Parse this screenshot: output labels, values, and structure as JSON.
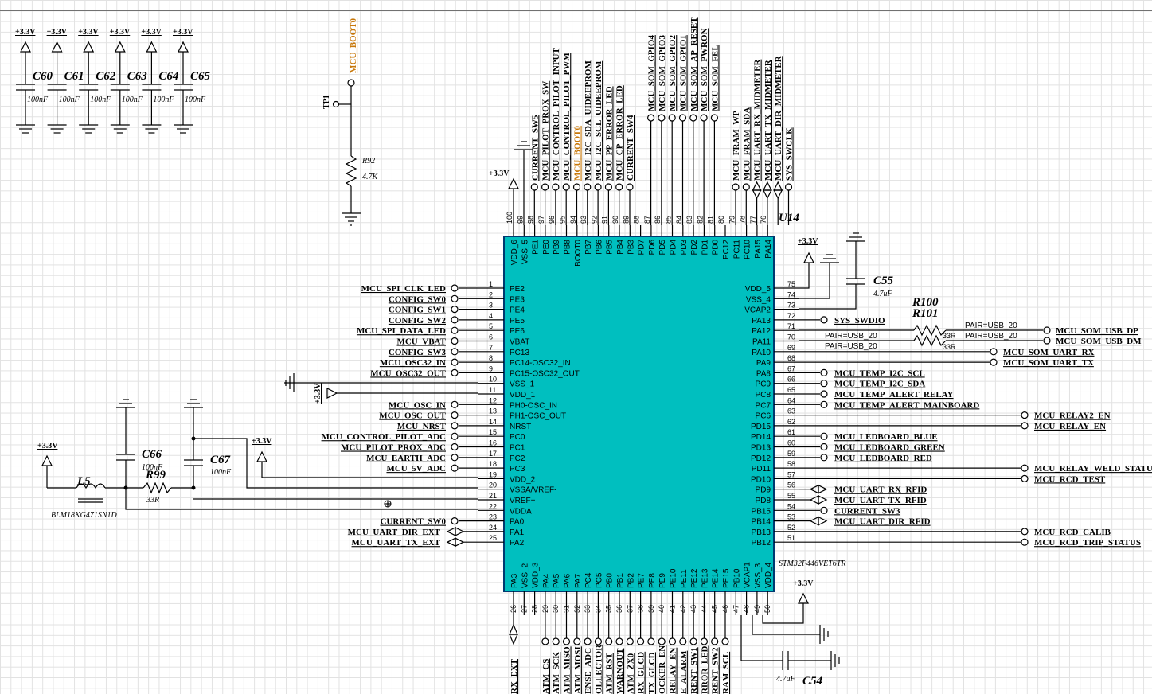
{
  "power": {
    "label": "+3.3V"
  },
  "decoupling": {
    "caps": [
      {
        "ref": "C60",
        "value": "100nF"
      },
      {
        "ref": "C61",
        "value": "100nF"
      },
      {
        "ref": "C62",
        "value": "100nF"
      },
      {
        "ref": "C63",
        "value": "100nF"
      },
      {
        "ref": "C64",
        "value": "100nF"
      },
      {
        "ref": "C65",
        "value": "100nF"
      }
    ]
  },
  "boot": {
    "net": "MCU_BOOT0",
    "tp": "TP1",
    "resistor_ref": "R92",
    "resistor_value": "4.7K"
  },
  "ic": {
    "ref": "U14",
    "part": "STM32F446VET6TR",
    "color": "#00bfbf",
    "left_pins": [
      {
        "num": "1",
        "name": "PE2",
        "net": "MCU_SPI_CLK_LED",
        "end": "circle"
      },
      {
        "num": "2",
        "name": "PE3",
        "net": "CONFIG_SW0",
        "end": "circle"
      },
      {
        "num": "3",
        "name": "PE4",
        "net": "CONFIG_SW1",
        "end": "circle"
      },
      {
        "num": "4",
        "name": "PE5",
        "net": "CONFIG_SW2",
        "end": "circle"
      },
      {
        "num": "5",
        "name": "PE6",
        "net": "MCU_SPI_DATA_LED",
        "end": "circle"
      },
      {
        "num": "6",
        "name": "VBAT",
        "net": "MCU_VBAT",
        "end": "circle"
      },
      {
        "num": "7",
        "name": "PC13",
        "net": "CONFIG_SW3",
        "end": "circle"
      },
      {
        "num": "8",
        "name": "PC14-OSC32_IN",
        "net": "MCU_OSC32_IN",
        "end": "circle"
      },
      {
        "num": "9",
        "name": "PC15-OSC32_OUT",
        "net": "MCU_OSC32_OUT",
        "end": "circle"
      },
      {
        "num": "10",
        "name": "VSS_1",
        "net": "",
        "end": "gnd"
      },
      {
        "num": "11",
        "name": "VDD_1",
        "net": "",
        "end": "pwr"
      },
      {
        "num": "12",
        "name": "PH0-OSC_IN",
        "net": "MCU_OSC_IN",
        "end": "circle"
      },
      {
        "num": "13",
        "name": "PH1-OSC_OUT",
        "net": "MCU_OSC_OUT",
        "end": "circle"
      },
      {
        "num": "14",
        "name": "NRST",
        "net": "MCU_NRST",
        "end": "circle"
      },
      {
        "num": "15",
        "name": "PC0",
        "net": "MCU_CONTROL_PILOT_ADC",
        "end": "circle"
      },
      {
        "num": "16",
        "name": "PC1",
        "net": "MCU_PILOT_PROX_ADC",
        "end": "circle"
      },
      {
        "num": "17",
        "name": "PC2",
        "net": "MCU_EARTH_ADC",
        "end": "circle"
      },
      {
        "num": "18",
        "name": "PC3",
        "net": "MCU_5V_ADC",
        "end": "circle"
      },
      {
        "num": "19",
        "name": "VDD_2",
        "net": "",
        "end": "none"
      },
      {
        "num": "20",
        "name": "VSSA/VREF-",
        "net": "",
        "end": "none"
      },
      {
        "num": "21",
        "name": "VREF+",
        "net": "",
        "end": "none"
      },
      {
        "num": "22",
        "name": "VDDA",
        "net": "",
        "end": "none"
      },
      {
        "num": "23",
        "name": "PA0",
        "net": "CURRENT_SW0",
        "end": "circle"
      },
      {
        "num": "24",
        "name": "PA1",
        "net": "MCU_UART_DIR_EXT",
        "end": "bidir"
      },
      {
        "num": "25",
        "name": "PA2",
        "net": "MCU_UART_TX_EXT",
        "end": "bidir"
      }
    ],
    "right_pins": [
      {
        "num": "75",
        "name": "VDD_5",
        "net": "",
        "end": "none"
      },
      {
        "num": "74",
        "name": "VSS_4",
        "net": "",
        "end": "none"
      },
      {
        "num": "73",
        "name": "VCAP2",
        "net": "",
        "end": "none"
      },
      {
        "num": "72",
        "name": "PA13",
        "net": "SYS_SWDIO",
        "end": "circle"
      },
      {
        "num": "71",
        "name": "PA12",
        "net": "",
        "end": "none"
      },
      {
        "num": "70",
        "name": "PA11",
        "net": "",
        "end": "none"
      },
      {
        "num": "69",
        "name": "PA10",
        "net": "MCU_SOM_UART_RX",
        "end": "far"
      },
      {
        "num": "68",
        "name": "PA9",
        "net": "MCU_SOM_UART_TX",
        "end": "far"
      },
      {
        "num": "67",
        "name": "PA8",
        "net": "MCU_TEMP_I2C_SCL",
        "end": "circle"
      },
      {
        "num": "66",
        "name": "PC9",
        "net": "MCU_TEMP_I2C_SDA",
        "end": "circle"
      },
      {
        "num": "65",
        "name": "PC8",
        "net": "MCU_TEMP_ALERT_RELAY",
        "end": "circle"
      },
      {
        "num": "64",
        "name": "PC7",
        "net": "MCU_TEMP_ALERT_MAINBOARD",
        "end": "circle"
      },
      {
        "num": "63",
        "name": "PC6",
        "net": "MCU_RELAY2_EN",
        "end": "far2"
      },
      {
        "num": "62",
        "name": "PD15",
        "net": "MCU_RELAY_EN",
        "end": "far2"
      },
      {
        "num": "61",
        "name": "PD14",
        "net": "MCU_LEDBOARD_BLUE",
        "end": "circle"
      },
      {
        "num": "60",
        "name": "PD13",
        "net": "MCU_LEDBOARD_GREEN",
        "end": "circle"
      },
      {
        "num": "59",
        "name": "PD12",
        "net": "MCU_LEDBOARD_RED",
        "end": "circle"
      },
      {
        "num": "58",
        "name": "PD11",
        "net": "MCU_RELAY_WELD_STATUS",
        "end": "far2"
      },
      {
        "num": "57",
        "name": "PD10",
        "net": "MCU_RCD_TEST",
        "end": "far2"
      },
      {
        "num": "56",
        "name": "PD9",
        "net": "MCU_UART_RX_RFID",
        "end": "bidir"
      },
      {
        "num": "55",
        "name": "PD8",
        "net": "MCU_UART_TX_RFID",
        "end": "bidir"
      },
      {
        "num": "54",
        "name": "PB15",
        "net": "CURRENT_SW3",
        "end": "circle"
      },
      {
        "num": "53",
        "name": "PB14",
        "net": "MCU_UART_DIR_RFID",
        "end": "bidir"
      },
      {
        "num": "52",
        "name": "PB13",
        "net": "MCU_RCD_CALIB",
        "end": "far2"
      },
      {
        "num": "51",
        "name": "PB12",
        "net": "MCU_RCD_TRIP_STATUS",
        "end": "far2"
      }
    ],
    "top_pins": [
      {
        "num": "100",
        "name": "VDD_6",
        "net": ""
      },
      {
        "num": "99",
        "name": "VSS_5",
        "net": "CURRENT_SW5"
      },
      {
        "num": "98",
        "name": "PE1",
        "net": "MCU_PILOT_PROX_SW"
      },
      {
        "num": "97",
        "name": "PE0",
        "net": "MCU_CONTROL_PILOT_INPUT"
      },
      {
        "num": "96",
        "name": "PB9",
        "net": "MCU_CONTROL_PILOT_PWM"
      },
      {
        "num": "95",
        "name": "PB8",
        "net": "MCU_BOOT0"
      },
      {
        "num": "94",
        "name": "BOOT0",
        "net": "MCU_I2C_SDA_UIDEEPROM"
      },
      {
        "num": "93",
        "name": "PB7",
        "net": "MCU_I2C_SCL_UIDEEPROM"
      },
      {
        "num": "92",
        "name": "PB6",
        "net": "MCU_PP_ERROR_LED"
      },
      {
        "num": "91",
        "name": "PB5",
        "net": "MCU_CP_ERROR_LED"
      },
      {
        "num": "90",
        "name": "PB4",
        "net": "CURRENT_SW4"
      },
      {
        "num": "89",
        "name": "PB3",
        "net": ""
      },
      {
        "num": "88",
        "name": "PD7",
        "net": "MCU_SOM_GPIO4"
      },
      {
        "num": "87",
        "name": "PD6",
        "net": "MCU_SOM_GPIO3"
      },
      {
        "num": "86",
        "name": "PD5",
        "net": "MCU_SOM_GPIO2"
      },
      {
        "num": "85",
        "name": "PD4",
        "net": "MCU_SOM_GPIO1"
      },
      {
        "num": "84",
        "name": "PD3",
        "net": "MCU_SOM_AP_RESET"
      },
      {
        "num": "83",
        "name": "PD2",
        "net": "MCU_SOM_PWRON"
      },
      {
        "num": "82",
        "name": "PD1",
        "net": "MCU_SOM_FEL"
      },
      {
        "num": "81",
        "name": "PD0",
        "net": ""
      },
      {
        "num": "80",
        "name": "PC12",
        "net": "MCU_FRAM_WP"
      },
      {
        "num": "79",
        "name": "PC11",
        "net": "MCU_FRAM_SDA"
      },
      {
        "num": "78",
        "name": "PC10",
        "net": "MCU_UART_RX_MIDMETER"
      },
      {
        "num": "77",
        "name": "PA15",
        "net": "MCU_UART_TX_MIDMETER"
      },
      {
        "num": "76",
        "name": "PA14",
        "net": "MCU_UART_DIR_MIDMETER"
      },
      {
        "num": "",
        "name": "",
        "net": "SYS_SWCLK"
      }
    ],
    "bottom_pins": [
      {
        "num": "26",
        "name": "PA3",
        "net": "RX_EXT"
      },
      {
        "num": "27",
        "name": "VSS_2",
        "net": ""
      },
      {
        "num": "28",
        "name": "VDD_3",
        "net": ""
      },
      {
        "num": "29",
        "name": "PA4",
        "net": "ATM_CS"
      },
      {
        "num": "30",
        "name": "PA5",
        "net": "ATM_SCK"
      },
      {
        "num": "31",
        "name": "PA6",
        "net": "ATM_MISO"
      },
      {
        "num": "32",
        "name": "PA7",
        "net": "ATM_MOSI"
      },
      {
        "num": "33",
        "name": "PC4",
        "net": "ENSE_ADC"
      },
      {
        "num": "34",
        "name": "PC5",
        "net": "OLLECTOR"
      },
      {
        "num": "35",
        "name": "PB0",
        "net": "ATM_RST"
      },
      {
        "num": "36",
        "name": "PB1",
        "net": "WARNOUT"
      },
      {
        "num": "37",
        "name": "PB2",
        "net": "ATM_ZX0"
      },
      {
        "num": "38",
        "name": "PE7",
        "net": "RX_GLCD"
      },
      {
        "num": "39",
        "name": "PE8",
        "net": "TX_GLCD"
      },
      {
        "num": "40",
        "name": "PE9",
        "net": "OCKER_EN"
      },
      {
        "num": "41",
        "name": "PE10",
        "net": "RELAY_EN"
      },
      {
        "num": "42",
        "name": "PE11",
        "net": "E_ALARM"
      },
      {
        "num": "43",
        "name": "PE12",
        "net": "RENT_SW1"
      },
      {
        "num": "44",
        "name": "PE13",
        "net": "RROR_LED"
      },
      {
        "num": "45",
        "name": "PE14",
        "net": "RENT_SW2"
      },
      {
        "num": "46",
        "name": "PE15",
        "net": "RAM_SCL"
      },
      {
        "num": "47",
        "name": "PB10",
        "net": ""
      },
      {
        "num": "48",
        "name": "VCAP1",
        "net": ""
      },
      {
        "num": "49",
        "name": "VSS_3",
        "net": ""
      },
      {
        "num": "50",
        "name": "VDD_4",
        "net": ""
      }
    ]
  },
  "analog": {
    "ferrite": "L5",
    "ferrite_part": "BLM18KG471SN1D",
    "r99": "R99",
    "r99_value": "33R",
    "c66": "C66",
    "c66_value": "100nF",
    "c67": "C67",
    "c67_value": "100nF"
  },
  "vcap": {
    "c55": "C55",
    "c55_value": "4.7uF",
    "c54": "C54",
    "c54_value": "4.7uF"
  },
  "usb": {
    "r100": "R100",
    "r101": "R101",
    "r_value": "33R",
    "pair": "PAIR=USB_20",
    "dp": "MCU_SOM_USB_DP",
    "dm": "MCU_SOM_USB_DM"
  }
}
